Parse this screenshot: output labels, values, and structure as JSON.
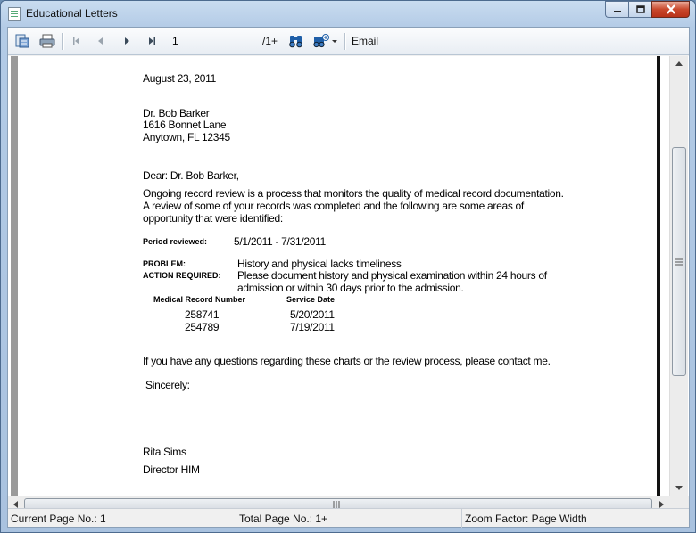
{
  "window": {
    "title": "Educational Letters"
  },
  "toolbar": {
    "page_value": "1",
    "page_of": "/1+",
    "email_label": "Email"
  },
  "letter": {
    "date": "August 23, 2011",
    "recipient_name": "Dr. Bob Barker",
    "recipient_street": "1616 Bonnet Lane",
    "recipient_city": "Anytown, FL 12345",
    "salutation": "Dear: Dr. Bob Barker,",
    "intro_line1": "Ongoing record review is a process that monitors the quality of medical record documentation.",
    "intro_line2": "A review of some of your records was completed and the following are some areas of",
    "intro_line3": "opportunity that were identified:",
    "period_label": "Period reviewed:",
    "period_value": "5/1/2011 - 7/31/2011",
    "problem_label": "PROBLEM:",
    "problem_value": "History and physical lacks timeliness",
    "action_label": "ACTION REQUIRED:",
    "action_line1": "Please document history and physical examination within 24 hours of",
    "action_line2": "admission or within 30 days prior to the admission.",
    "table_headers": {
      "mrn": "Medical Record Number",
      "date": "Service Date"
    },
    "table_rows": [
      {
        "mrn": "258741",
        "date": "5/20/2011"
      },
      {
        "mrn": "254789",
        "date": "7/19/2011"
      }
    ],
    "closing_question": "If you have any questions regarding these charts or the review process, please contact me.",
    "sign_off": "Sincerely:",
    "signer_name": "Rita Sims",
    "signer_title": "Director HIM"
  },
  "status": {
    "current_page": "Current Page No.: 1",
    "total_page": "Total Page No.: 1+",
    "zoom": "Zoom Factor: Page Width"
  },
  "icons": [
    "app-icon",
    "export-icon",
    "print-icon",
    "first-page-icon",
    "prev-page-icon",
    "next-page-icon",
    "last-page-icon",
    "find-icon",
    "zoom-icon",
    "minimize-icon",
    "maximize-icon",
    "close-icon"
  ]
}
